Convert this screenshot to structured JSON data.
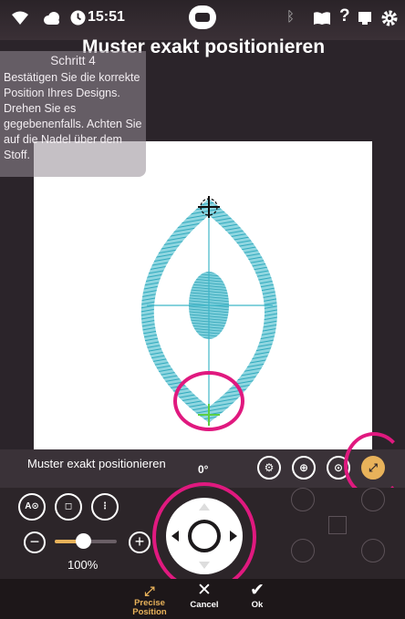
{
  "status_bar": {
    "time": "15:51",
    "icons": [
      "wifi-icon",
      "cloud-icon",
      "clock-icon",
      "machine-logo-icon",
      "bluetooth-icon",
      "book-icon",
      "help-icon",
      "monitor-icon",
      "gear-icon"
    ]
  },
  "title": "Muster exakt positionieren",
  "help": {
    "step": "Schritt 4",
    "text": "Bestätigen Sie die korrekte Position Ihres Designs. Drehen Sie es gegebenenfalls. Achten Sie auf die Nadel über dem Stoff."
  },
  "toolbar": {
    "label": "Muster exakt positionieren",
    "angle": "0°"
  },
  "zoom": {
    "value": "100%",
    "level": 0.45
  },
  "footer": {
    "precise_label": "Precise Position",
    "cancel_label": "Cancel",
    "ok_label": "Ok"
  },
  "colors": {
    "accent": "#e8b25a",
    "highlight": "#e0197f",
    "stitch": "#3fb6c8",
    "needle_cross": "#5ccf45"
  }
}
